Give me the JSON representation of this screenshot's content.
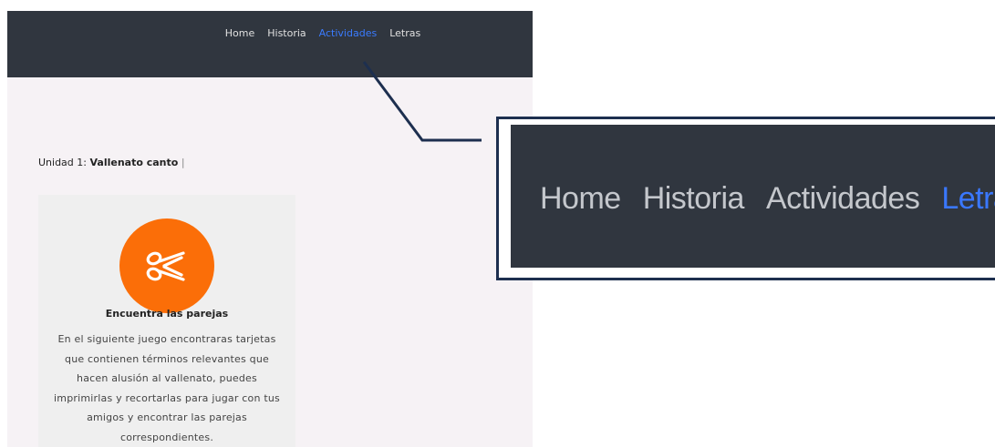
{
  "nav": {
    "items": [
      "Home",
      "Historia",
      "Actividades",
      "Letras"
    ],
    "active_index": 2
  },
  "unit": {
    "prefix": "Unidad 1:",
    "title": "Vallenato canto",
    "separator": "|"
  },
  "card": {
    "icon": "scissors-icon",
    "title": "Encuentra las parejas",
    "description": "En el siguiente juego encontraras tarjetas que contienen términos relevantes que hacen alusión al vallenato, puedes imprimirlas y recortarlas para jugar con tus amigos y encontrar las parejas correspondientes."
  },
  "zoom": {
    "items": [
      "Home",
      "Historia",
      "Actividades",
      "Letras"
    ],
    "active_index": 3
  },
  "colors": {
    "navbar": "#30363f",
    "active_link": "#3a7bff",
    "icon_bg": "#fb6e08",
    "zoom_border": "#1d2f4f"
  }
}
